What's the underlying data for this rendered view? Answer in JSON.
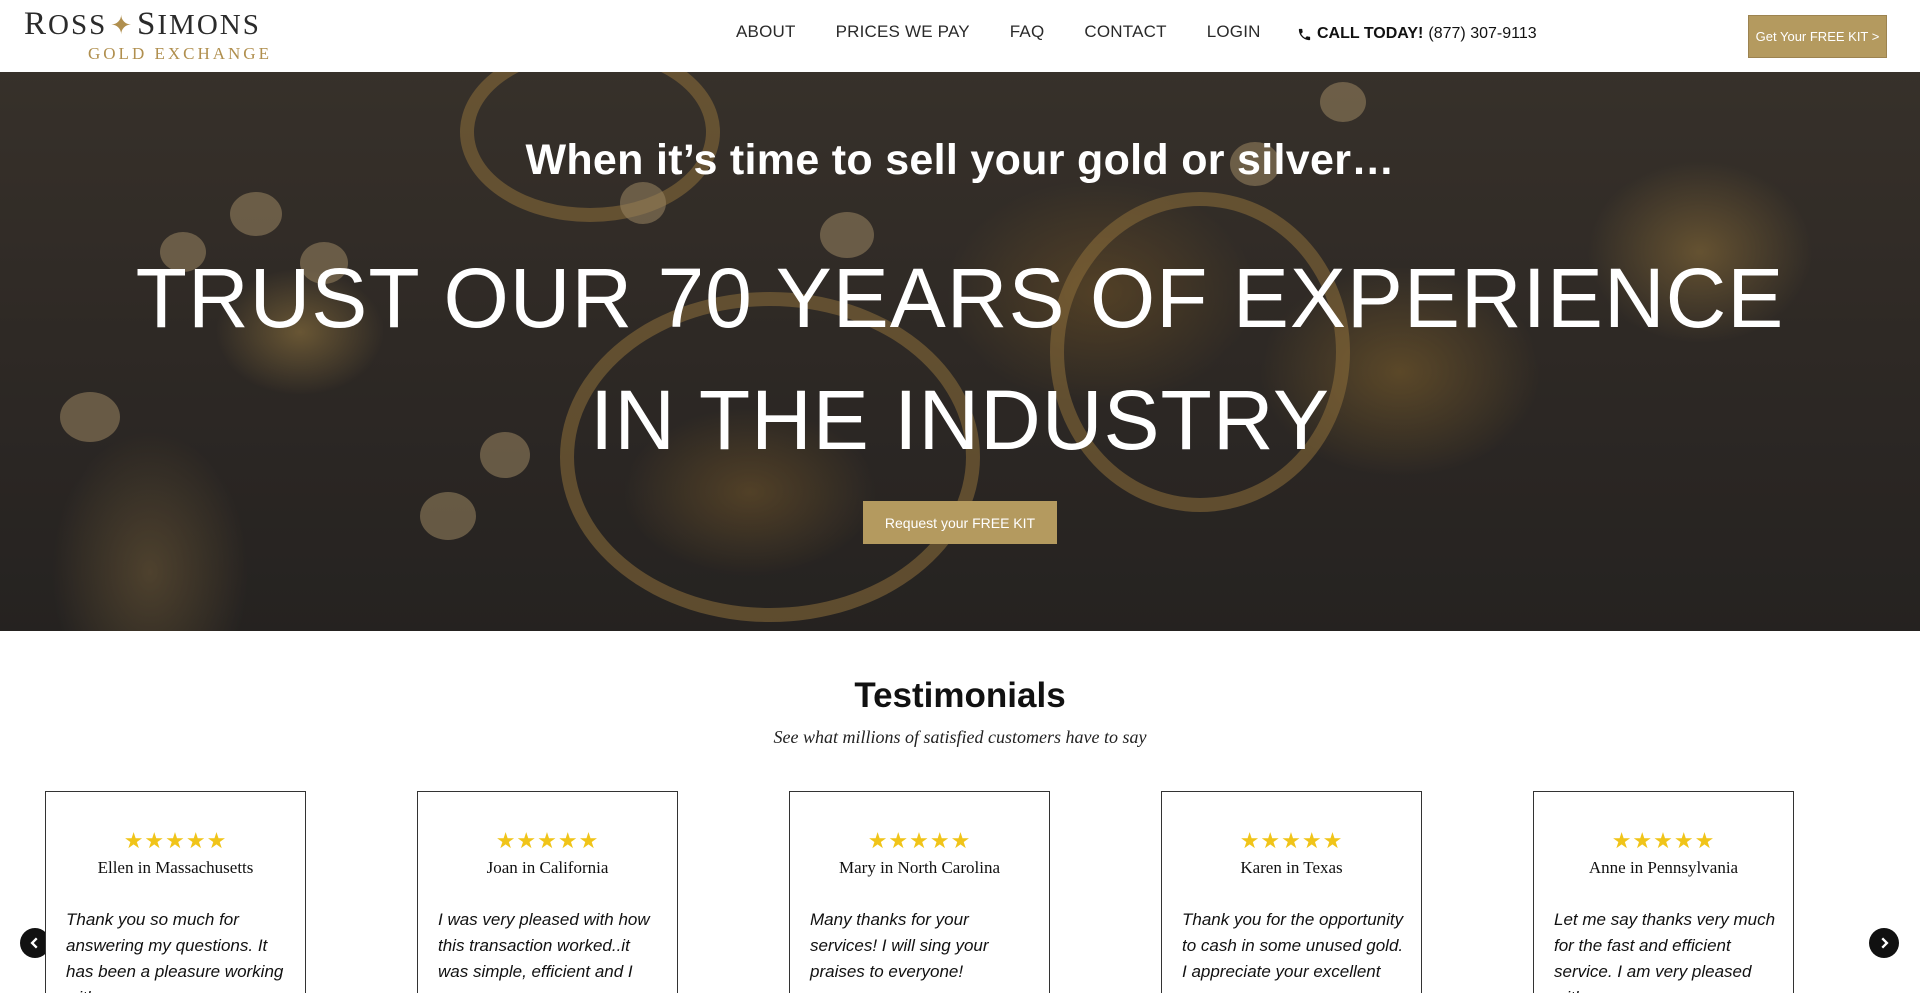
{
  "header": {
    "logo": {
      "top": "Ross Simons",
      "bottom": "GOLD EXCHANGE"
    },
    "nav": [
      "ABOUT",
      "PRICES WE PAY",
      "FAQ",
      "CONTACT",
      "LOGIN"
    ],
    "phone": {
      "prefix": "CALL TODAY!",
      "number": "(877) 307-9113"
    },
    "cta_label": "Get Your FREE KIT >"
  },
  "hero": {
    "subtitle": "When it’s time to sell your gold or silver…",
    "title_line1": "TRUST OUR 70 YEARS OF EXPERIENCE",
    "title_line2": "IN THE INDUSTRY",
    "button_label": "Request your FREE KIT"
  },
  "testimonials": {
    "title": "Testimonials",
    "subtitle": "See what millions of satisfied customers have to say",
    "rating": 5,
    "cards": [
      {
        "name": "Ellen in Massachusetts",
        "text": "Thank you so much for answering my questions. It has been a pleasure working with"
      },
      {
        "name": "Joan in California",
        "text": "I was very pleased with how this transaction worked..it was simple, efficient and I was"
      },
      {
        "name": "Mary in North Carolina",
        "text": "Many thanks for your services! I will sing your praises to everyone!"
      },
      {
        "name": "Karen in Texas",
        "text": "Thank you for the opportunity to cash in some unused gold. I appreciate your excellent"
      },
      {
        "name": "Anne in Pennsylvania",
        "text": "Let me say thanks very much for the fast and efficient service. I am very pleased with"
      }
    ]
  },
  "colors": {
    "gold": "#b49a5f",
    "logo_gold": "#b08f4e",
    "star": "#f0c419"
  },
  "icons": [
    "phone-icon",
    "star-icon",
    "chevron-left-icon",
    "chevron-right-icon"
  ]
}
